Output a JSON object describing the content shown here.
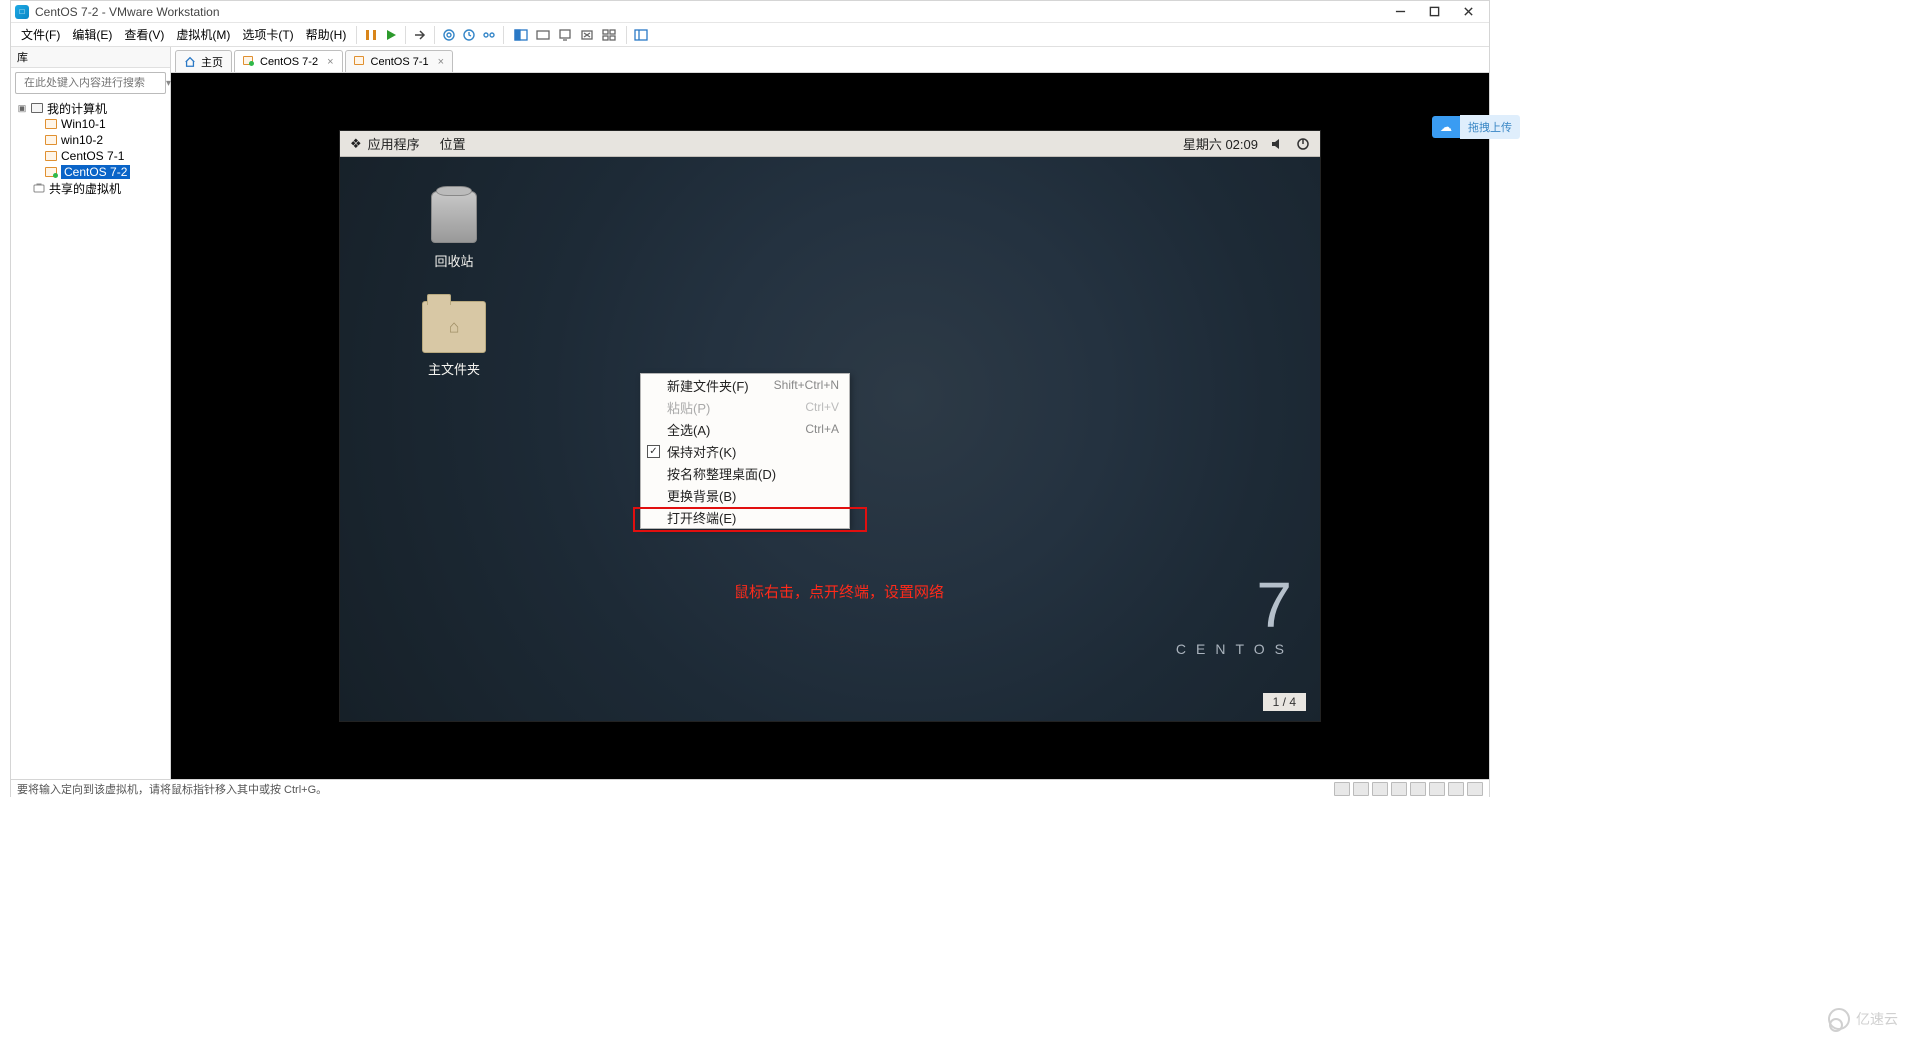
{
  "titlebar": {
    "title": "CentOS 7-2 - VMware Workstation"
  },
  "menu": {
    "file": "文件(F)",
    "edit": "编辑(E)",
    "view": "查看(V)",
    "vm": "虚拟机(M)",
    "tabs": "选项卡(T)",
    "help": "帮助(H)"
  },
  "sidebar": {
    "header": "库",
    "search_placeholder": "在此处键入内容进行搜索",
    "root": "我的计算机",
    "items": [
      "Win10-1",
      "win10-2",
      "CentOS 7-1",
      "CentOS 7-2"
    ],
    "shared": "共享的虚拟机"
  },
  "tabs": {
    "home": "主页",
    "t1": "CentOS 7-2",
    "t2": "CentOS 7-1"
  },
  "guest": {
    "apps": "应用程序",
    "places": "位置",
    "datetime": "星期六 02:09",
    "trash": "回收站",
    "home": "主文件夹",
    "brand_num": "7",
    "brand_name": "CENTOS",
    "annot": "鼠标右击，点开终端，设置网络",
    "pager": "1 / 4"
  },
  "ctx": {
    "new_folder": "新建文件夹(F)",
    "new_folder_sc": "Shift+Ctrl+N",
    "paste": "粘贴(P)",
    "paste_sc": "Ctrl+V",
    "select_all": "全选(A)",
    "select_all_sc": "Ctrl+A",
    "keep_aligned": "保持对齐(K)",
    "organize": "按名称整理桌面(D)",
    "change_bg": "更换背景(B)",
    "terminal": "打开终端(E)"
  },
  "badge": {
    "label": "拖拽上传"
  },
  "status": {
    "text": "要将输入定向到该虚拟机，请将鼠标指针移入其中或按 Ctrl+G。"
  },
  "watermark": {
    "text": "亿速云"
  }
}
